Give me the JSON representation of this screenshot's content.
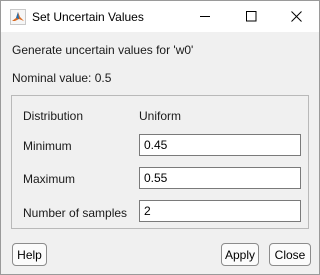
{
  "window": {
    "title": "Set Uncertain Values",
    "app_icon": "matlab-icon",
    "controls": [
      "minimize-icon",
      "maximize-icon",
      "close-icon"
    ]
  },
  "header": "Generate uncertain values for 'w0'",
  "nominal": "Nominal value: 0.5",
  "panel": {
    "distribution_label": "Distribution",
    "distribution_value": "Uniform",
    "minimum_label": "Minimum",
    "minimum_value": "0.45",
    "maximum_label": "Maximum",
    "maximum_value": "0.55",
    "samples_label": "Number of samples",
    "samples_value": "2"
  },
  "buttons": {
    "help": "Help",
    "apply": "Apply",
    "close": "Close"
  },
  "colors": {
    "dialog_bg": "#f0f0f0",
    "titlebar_bg": "#ffffff",
    "field_border": "#7a7a7a"
  }
}
